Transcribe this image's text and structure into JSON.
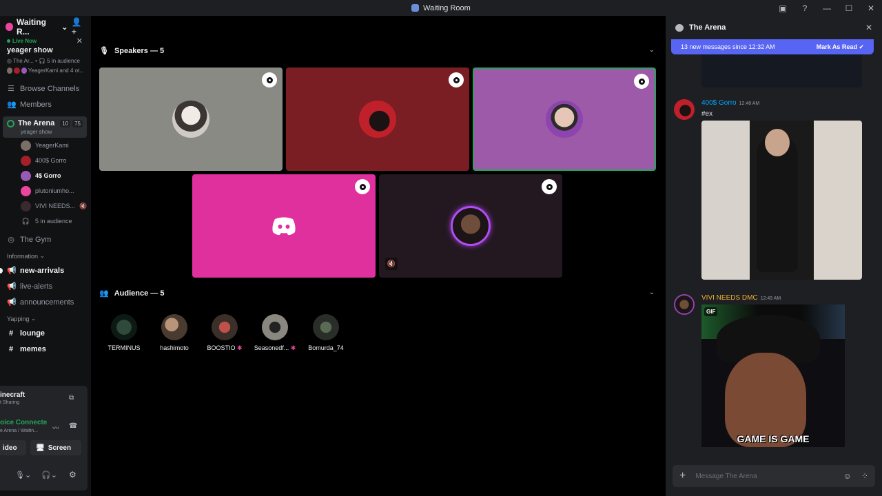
{
  "window": {
    "title": "Waiting Room"
  },
  "server": {
    "name": "Waiting R..."
  },
  "live_now": {
    "label": "Live Now",
    "stream_name": "yeager show",
    "channel_info": "The Ar...",
    "audience": "5 in audience",
    "viewers": "YeagerKami and 4 ot..."
  },
  "nav": {
    "browse": "Browse Channels",
    "members": "Members"
  },
  "active_channel": {
    "name": "The Arena",
    "count1": "10",
    "count2": "75",
    "subtitle": "yeager show"
  },
  "voice_members": [
    {
      "name": "YeagerKami",
      "color": "#7a6f67"
    },
    {
      "name": "400$ Gorro",
      "color": "#a3202a"
    },
    {
      "name": "4$ Gorro",
      "color": "#9b59b6"
    },
    {
      "name": "plutoniumho...",
      "color": "#eb459e"
    },
    {
      "name": "VIVI NEEDS...",
      "color": "#3a2a2e"
    }
  ],
  "in_audience": "5 in audience",
  "other_voice": "The Gym",
  "categories": {
    "information": "Information",
    "yapping": "Yapping"
  },
  "info_channels": [
    "new-arrivals",
    "live-alerts",
    "announcements"
  ],
  "yap_channels": [
    "lounge",
    "memes"
  ],
  "bottom": {
    "activity": "inecraft",
    "activity_sub": "t Sharing",
    "voice": "oice Connecte",
    "voice_sub": "e Arena / Waitin...",
    "video": "ideo",
    "screen": "Screen"
  },
  "speakers": {
    "label": "Speakers — 5"
  },
  "audience": {
    "label": "Audience — 5",
    "members": [
      "TERMINUS",
      "hashimoto",
      "BOOSTIO",
      "Seasonedf...",
      "Bomurda_74"
    ]
  },
  "chat": {
    "title": "The Arena",
    "new_messages": "13 new messages since 12:32 AM",
    "mark_read": "Mark As Read",
    "messages": [
      {
        "author": "400$ Gorro",
        "time": "12:48 AM",
        "text": "#ex",
        "color": "#00a8fc"
      },
      {
        "author": "VIVI NEEDS DMC",
        "time": "12:49 AM",
        "gif_label": "GIF",
        "gif_caption": "GAME IS GAME",
        "color": "#f0b232"
      }
    ],
    "placeholder": "Message The Arena"
  }
}
